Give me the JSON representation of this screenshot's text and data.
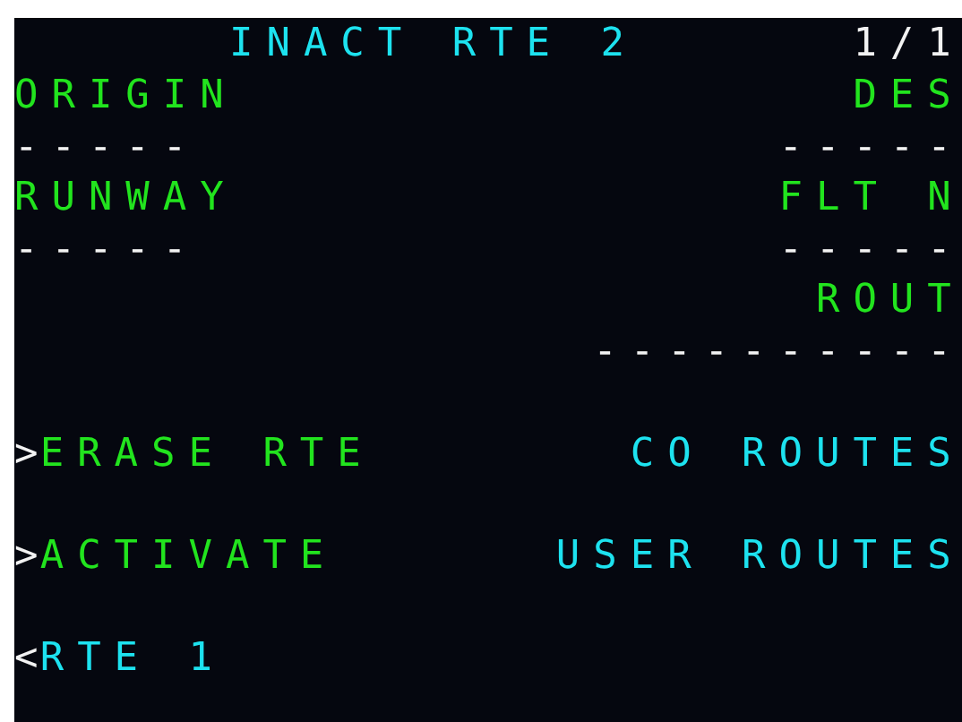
{
  "title": {
    "text": "INACT RTE 2",
    "page": "1/1"
  },
  "lines": [
    {
      "left": [
        {
          "text": "ORIGIN",
          "kind": "label"
        }
      ],
      "right": [
        {
          "text": "DES",
          "kind": "label"
        }
      ]
    },
    {
      "left": [
        {
          "text": "-----",
          "kind": "dashes"
        }
      ],
      "right": [
        {
          "text": "-----",
          "kind": "dashes"
        }
      ]
    },
    {
      "left": [
        {
          "text": "RUNWAY",
          "kind": "label"
        }
      ],
      "right": [
        {
          "text": "FLT N",
          "kind": "label"
        }
      ]
    },
    {
      "left": [
        {
          "text": "-----",
          "kind": "dashes"
        }
      ],
      "right": [
        {
          "text": "-----",
          "kind": "dashes"
        }
      ]
    },
    {
      "right": [
        {
          "text": "ROUT",
          "kind": "label"
        }
      ]
    },
    {
      "right": [
        {
          "text": "----------",
          "kind": "dashes"
        }
      ]
    },
    {
      "left": [
        {
          "text": ">",
          "kind": "prompt"
        },
        {
          "text": "ERASE RTE",
          "kind": "action"
        }
      ],
      "right": [
        {
          "text": "CO ROUTES",
          "kind": "link"
        }
      ]
    },
    {
      "left": [
        {
          "text": ">",
          "kind": "prompt"
        },
        {
          "text": "ACTIVATE",
          "kind": "action"
        }
      ],
      "right": [
        {
          "text": "USER ROUTES",
          "kind": "link"
        }
      ]
    },
    {
      "left": [
        {
          "text": "<",
          "kind": "prompt"
        },
        {
          "text": "RTE 1",
          "kind": "link"
        }
      ]
    }
  ]
}
